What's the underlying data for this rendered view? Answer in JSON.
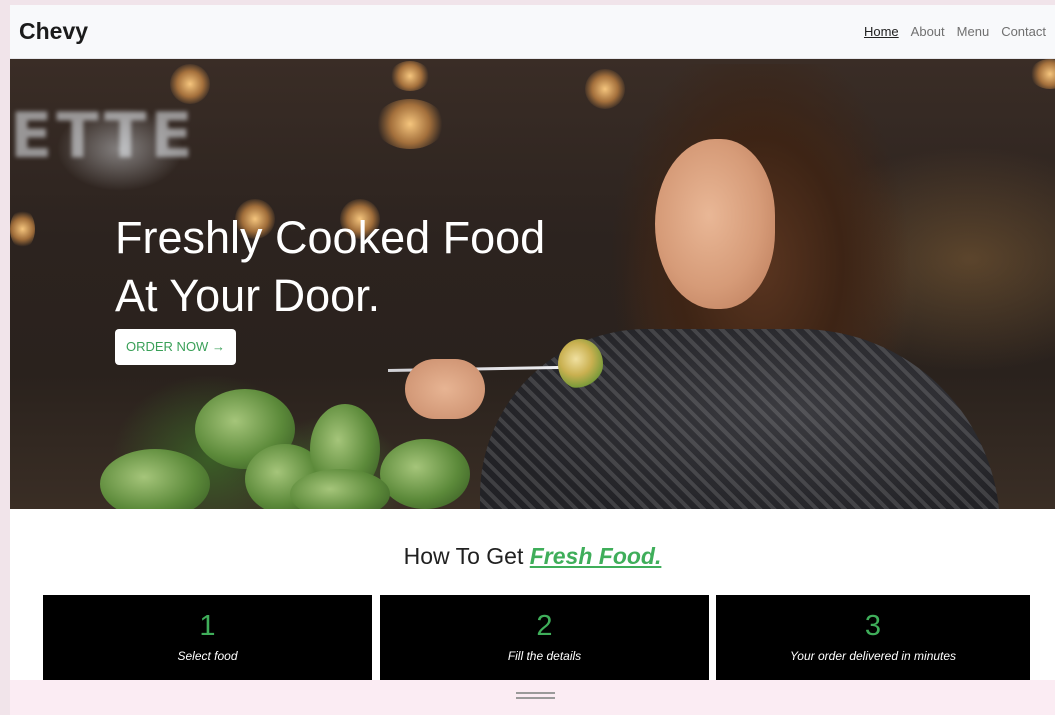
{
  "navbar": {
    "brand": "Chevy",
    "links": [
      {
        "label": "Home",
        "active": true
      },
      {
        "label": "About"
      },
      {
        "label": "Menu"
      },
      {
        "label": "Contact"
      }
    ]
  },
  "hero": {
    "title_line1": "Freshly Cooked Food",
    "title_line2": "At Your Door.",
    "cta_label": "ORDER NOW",
    "cta_icon": "arrow-right-icon"
  },
  "steps": {
    "title_prefix": "How To Get",
    "title_highlight": "Fresh Food.",
    "cards": [
      {
        "number": "1",
        "label": "Select food"
      },
      {
        "number": "2",
        "label": "Fill the details"
      },
      {
        "number": "3",
        "label": "Your order delivered in minutes"
      }
    ]
  },
  "colors": {
    "accent": "#3fae5a",
    "navbar_bg": "#f8f9fb",
    "card_bg": "#000000",
    "drawer_bg": "#fbecf3"
  },
  "drawer": {
    "icon": "drag-handle-icon"
  }
}
